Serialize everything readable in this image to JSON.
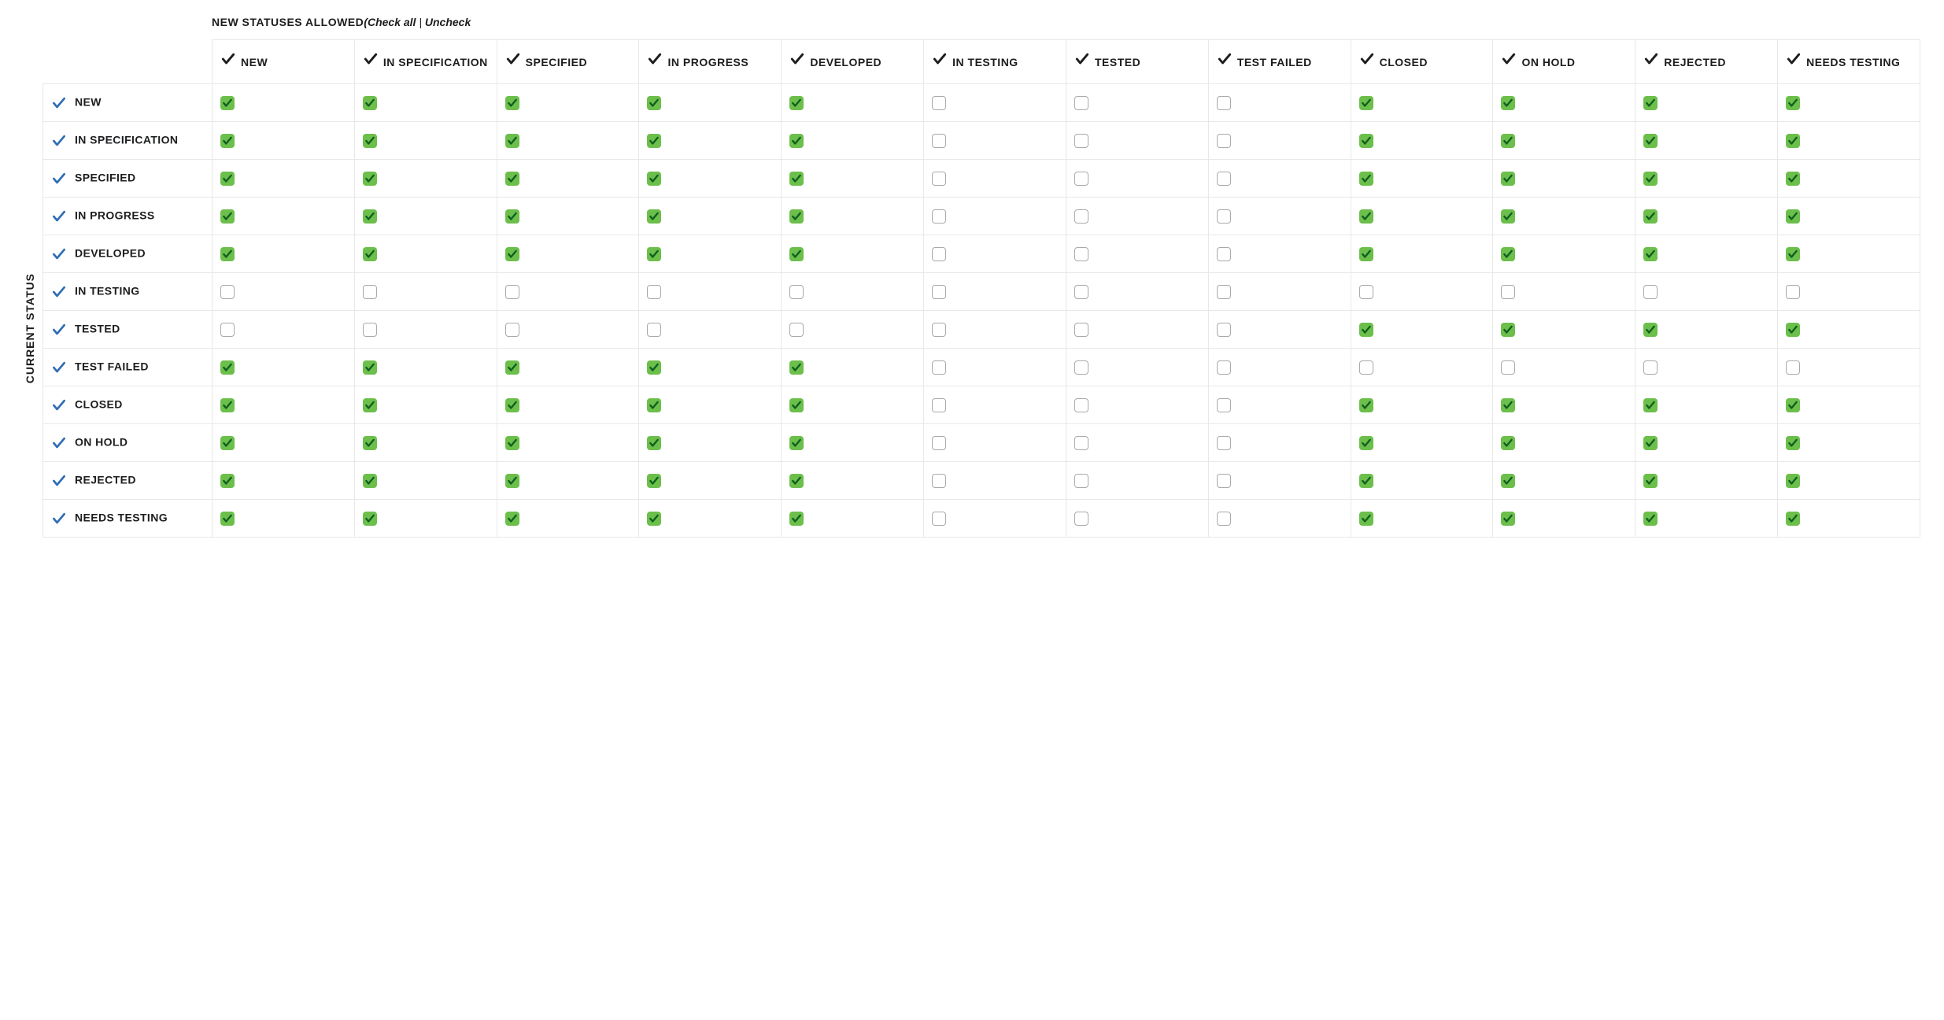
{
  "header": {
    "title": "NEW STATUSES ALLOWED",
    "check_all_label": "Check all",
    "uncheck_label": "Uncheck"
  },
  "side_label": "CURRENT STATUS",
  "columns": [
    "NEW",
    "IN SPECIFICATION",
    "SPECIFIED",
    "IN PROGRESS",
    "DEVELOPED",
    "IN TESTING",
    "TESTED",
    "TEST FAILED",
    "CLOSED",
    "ON HOLD",
    "REJECTED",
    "NEEDS TESTING"
  ],
  "rows": [
    {
      "label": "NEW",
      "cells": [
        true,
        true,
        true,
        true,
        true,
        false,
        false,
        false,
        true,
        true,
        true,
        true
      ]
    },
    {
      "label": "IN SPECIFICATION",
      "cells": [
        true,
        true,
        true,
        true,
        true,
        false,
        false,
        false,
        true,
        true,
        true,
        true
      ]
    },
    {
      "label": "SPECIFIED",
      "cells": [
        true,
        true,
        true,
        true,
        true,
        false,
        false,
        false,
        true,
        true,
        true,
        true
      ]
    },
    {
      "label": "IN PROGRESS",
      "cells": [
        true,
        true,
        true,
        true,
        true,
        false,
        false,
        false,
        true,
        true,
        true,
        true
      ]
    },
    {
      "label": "DEVELOPED",
      "cells": [
        true,
        true,
        true,
        true,
        true,
        false,
        false,
        false,
        true,
        true,
        true,
        true
      ]
    },
    {
      "label": "IN TESTING",
      "cells": [
        false,
        false,
        false,
        false,
        false,
        false,
        false,
        false,
        false,
        false,
        false,
        false
      ]
    },
    {
      "label": "TESTED",
      "cells": [
        false,
        false,
        false,
        false,
        false,
        false,
        false,
        false,
        true,
        true,
        true,
        true
      ]
    },
    {
      "label": "TEST FAILED",
      "cells": [
        true,
        true,
        true,
        true,
        true,
        false,
        false,
        false,
        false,
        false,
        false,
        false
      ]
    },
    {
      "label": "CLOSED",
      "cells": [
        true,
        true,
        true,
        true,
        true,
        false,
        false,
        false,
        true,
        true,
        true,
        true
      ]
    },
    {
      "label": "ON HOLD",
      "cells": [
        true,
        true,
        true,
        true,
        true,
        false,
        false,
        false,
        true,
        true,
        true,
        true
      ]
    },
    {
      "label": "REJECTED",
      "cells": [
        true,
        true,
        true,
        true,
        true,
        false,
        false,
        false,
        true,
        true,
        true,
        true
      ]
    },
    {
      "label": "NEEDS TESTING",
      "cells": [
        true,
        true,
        true,
        true,
        true,
        false,
        false,
        false,
        true,
        true,
        true,
        true
      ]
    }
  ]
}
